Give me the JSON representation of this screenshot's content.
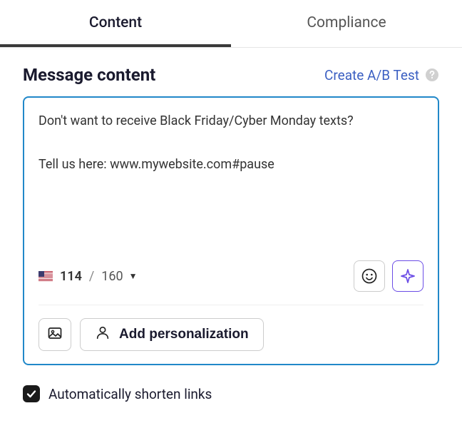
{
  "tabs": {
    "content": "Content",
    "compliance": "Compliance"
  },
  "header": {
    "title": "Message content",
    "ab_test": "Create A/B Test"
  },
  "message": {
    "text": "Don't want to receive Black Friday/Cyber Monday texts?\n\nTell us here: www.mywebsite.com#pause"
  },
  "counter": {
    "used": "114",
    "separator": "/",
    "max": "160"
  },
  "buttons": {
    "add_personalization": "Add personalization"
  },
  "checkbox": {
    "shorten_links": "Automatically shorten links"
  }
}
